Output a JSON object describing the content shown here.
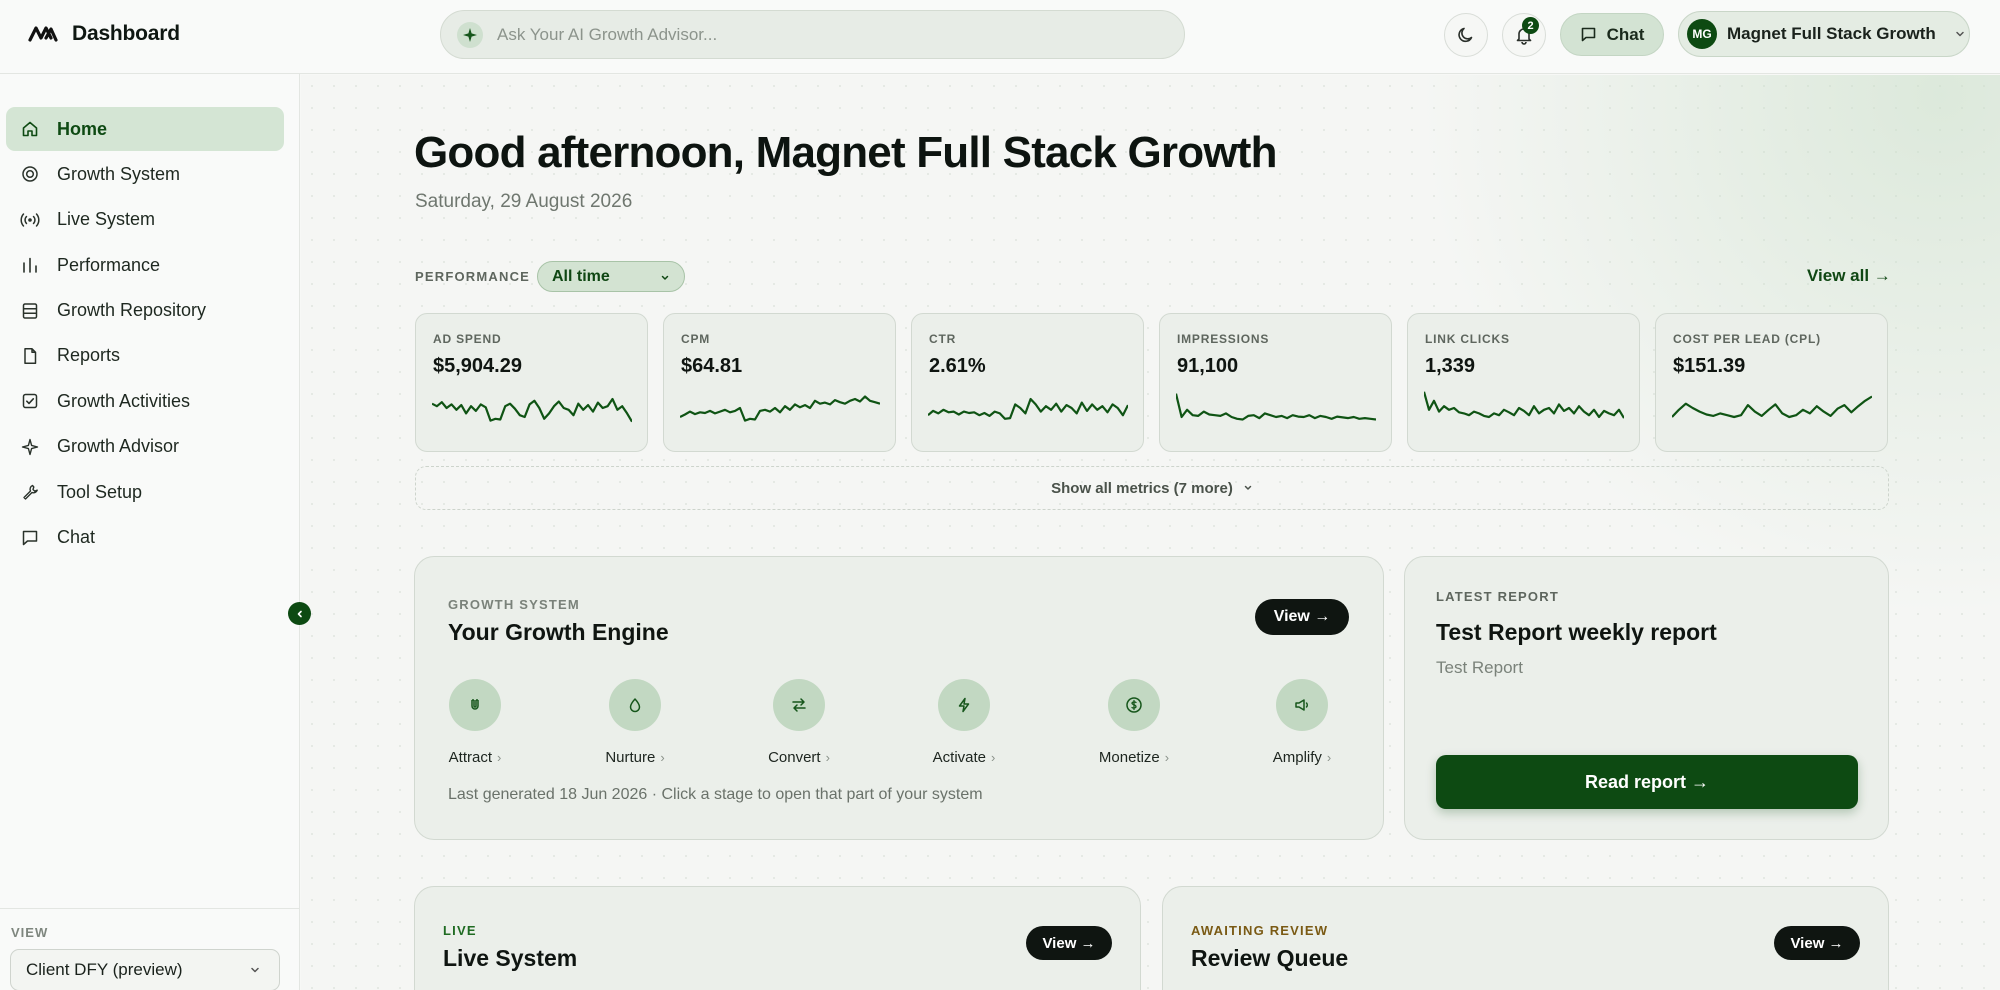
{
  "app": {
    "title": "Dashboard",
    "search_placeholder": "Ask Your AI Growth Advisor...",
    "notification_count": "2",
    "chat_label": "Chat",
    "account": {
      "initials": "MG",
      "name": "Magnet Full Stack Growth"
    }
  },
  "sidebar": {
    "items": [
      {
        "label": "Home",
        "icon": "home-icon",
        "active": true
      },
      {
        "label": "Growth System",
        "icon": "target-icon"
      },
      {
        "label": "Live System",
        "icon": "broadcast-icon"
      },
      {
        "label": "Performance",
        "icon": "bar-chart-icon"
      },
      {
        "label": "Growth Repository",
        "icon": "database-icon"
      },
      {
        "label": "Reports",
        "icon": "file-icon"
      },
      {
        "label": "Growth Activities",
        "icon": "checkbox-icon"
      },
      {
        "label": "Growth Advisor",
        "icon": "sparkle-icon"
      },
      {
        "label": "Tool Setup",
        "icon": "wrench-icon"
      },
      {
        "label": "Chat",
        "icon": "chat-icon"
      }
    ],
    "view_label": "VIEW",
    "view_value": "Client DFY (preview)"
  },
  "main": {
    "greeting": "Good afternoon, Magnet Full Stack Growth",
    "date": "Saturday, 29 August 2026",
    "performance_label": "PERFORMANCE",
    "range_value": "All time",
    "view_all": "View all →",
    "metrics": [
      {
        "label": "AD SPEND",
        "value": "$5,904.29"
      },
      {
        "label": "CPM",
        "value": "$64.81"
      },
      {
        "label": "CTR",
        "value": "2.61%"
      },
      {
        "label": "IMPRESSIONS",
        "value": "91,100"
      },
      {
        "label": "LINK CLICKS",
        "value": "1,339"
      },
      {
        "label": "COST PER LEAD (CPL)",
        "value": "$151.39"
      }
    ],
    "show_more": "Show all metrics (7 more)",
    "growth_engine": {
      "eyebrow": "GROWTH SYSTEM",
      "title": "Your Growth Engine",
      "view_label": "View →",
      "stages": [
        {
          "label": "Attract",
          "icon": "magnet-icon"
        },
        {
          "label": "Nurture",
          "icon": "droplet-icon"
        },
        {
          "label": "Convert",
          "icon": "arrows-swap-icon"
        },
        {
          "label": "Activate",
          "icon": "lightning-icon"
        },
        {
          "label": "Monetize",
          "icon": "dollar-icon"
        },
        {
          "label": "Amplify",
          "icon": "megaphone-icon"
        }
      ],
      "note": "Last generated 18 Jun 2026 · Click a stage to open that part of your system"
    },
    "latest_report": {
      "eyebrow": "LATEST REPORT",
      "title": "Test Report weekly report",
      "subtitle": "Test Report",
      "button": "Read report →"
    },
    "live_system": {
      "eyebrow": "LIVE",
      "title": "Live System",
      "view_label": "View →"
    },
    "review_queue": {
      "eyebrow": "AWAITING REVIEW",
      "title": "Review Queue",
      "view_label": "View →"
    }
  },
  "sparklines": [
    [
      0.62,
      0.55,
      0.66,
      0.5,
      0.6,
      0.45,
      0.58,
      0.35,
      0.55,
      0.42,
      0.6,
      0.52,
      0.15,
      0.2,
      0.18,
      0.55,
      0.62,
      0.48,
      0.3,
      0.25,
      0.6,
      0.7,
      0.5,
      0.2,
      0.35,
      0.55,
      0.68,
      0.5,
      0.45,
      0.3,
      0.62,
      0.45,
      0.58,
      0.4,
      0.65,
      0.5,
      0.55,
      0.75,
      0.45,
      0.55,
      0.35,
      0.12
    ],
    [
      0.25,
      0.32,
      0.4,
      0.33,
      0.38,
      0.36,
      0.42,
      0.35,
      0.4,
      0.45,
      0.38,
      0.42,
      0.5,
      0.15,
      0.2,
      0.18,
      0.42,
      0.45,
      0.4,
      0.5,
      0.38,
      0.55,
      0.45,
      0.6,
      0.52,
      0.58,
      0.5,
      0.7,
      0.62,
      0.65,
      0.6,
      0.72,
      0.66,
      0.62,
      0.7,
      0.75,
      0.68,
      0.82,
      0.7,
      0.66,
      0.62
    ],
    [
      0.3,
      0.42,
      0.35,
      0.45,
      0.38,
      0.4,
      0.32,
      0.4,
      0.36,
      0.38,
      0.3,
      0.36,
      0.28,
      0.4,
      0.35,
      0.2,
      0.22,
      0.6,
      0.5,
      0.35,
      0.75,
      0.6,
      0.4,
      0.55,
      0.45,
      0.62,
      0.4,
      0.58,
      0.5,
      0.35,
      0.65,
      0.42,
      0.6,
      0.45,
      0.55,
      0.38,
      0.6,
      0.5,
      0.3,
      0.58
    ],
    [
      0.9,
      0.25,
      0.45,
      0.3,
      0.28,
      0.4,
      0.32,
      0.3,
      0.28,
      0.35,
      0.25,
      0.2,
      0.18,
      0.28,
      0.3,
      0.22,
      0.35,
      0.3,
      0.25,
      0.28,
      0.22,
      0.3,
      0.26,
      0.25,
      0.3,
      0.22,
      0.28,
      0.25,
      0.2,
      0.26,
      0.24,
      0.22,
      0.25,
      0.2,
      0.22,
      0.2,
      0.18
    ],
    [
      0.95,
      0.45,
      0.7,
      0.4,
      0.55,
      0.45,
      0.5,
      0.38,
      0.35,
      0.3,
      0.4,
      0.35,
      0.28,
      0.25,
      0.35,
      0.3,
      0.45,
      0.38,
      0.3,
      0.5,
      0.42,
      0.3,
      0.55,
      0.35,
      0.45,
      0.5,
      0.35,
      0.6,
      0.42,
      0.5,
      0.35,
      0.55,
      0.4,
      0.3,
      0.45,
      0.25,
      0.42,
      0.35,
      0.3,
      0.45,
      0.22
    ],
    [
      0.25,
      0.45,
      0.62,
      0.5,
      0.4,
      0.32,
      0.28,
      0.35,
      0.3,
      0.25,
      0.3,
      0.58,
      0.4,
      0.28,
      0.45,
      0.6,
      0.35,
      0.25,
      0.3,
      0.45,
      0.35,
      0.55,
      0.4,
      0.28,
      0.48,
      0.58,
      0.38,
      0.55,
      0.7,
      0.82
    ]
  ]
}
